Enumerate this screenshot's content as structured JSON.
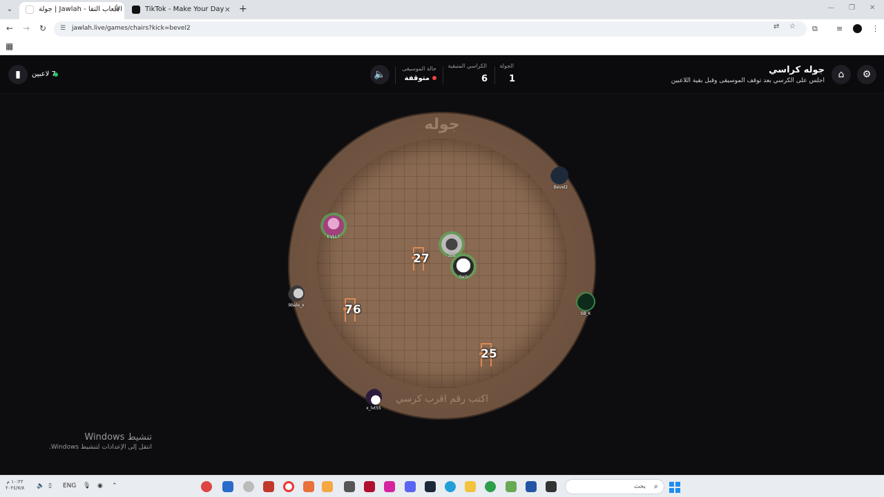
{
  "browser": {
    "tabs": [
      {
        "title": "جولة | Jawlah - منصة الألعاب التفا"
      },
      {
        "title": "TikTok - Make Your Day"
      }
    ],
    "url": "jawlah.live/games/chairs?kick=bevel2",
    "new_tab": "+",
    "close": "×"
  },
  "header": {
    "title": "جوله كراسي",
    "subtitle": "اجلس على الكرسي بعد توقف الموسيقى وقبل بقية اللاعبين",
    "round_label": "الجولة",
    "round_value": "1",
    "chairs_label": "الكراسي المتبقية",
    "chairs_value": "6",
    "music_label": "حالة الموسيقى",
    "music_value": "متوقفة",
    "players_count": "7 لاعبين"
  },
  "board": {
    "brand": "جوله",
    "hint": "اكتب رقم اقرب كرسي",
    "chairs": [
      {
        "number": "27"
      },
      {
        "number": "76"
      },
      {
        "number": "25"
      }
    ],
    "players": [
      {
        "name": "Bevel2"
      },
      {
        "name": "EVLL7"
      },
      {
        "name": "3bd"
      },
      {
        "name": "fer0"
      },
      {
        "name": "9bale_x"
      },
      {
        "name": "SB_K"
      },
      {
        "name": "x_lvt55"
      }
    ]
  },
  "watermark": {
    "title": "تنشيط Windows",
    "subtitle": "انتقل إلى الإعدادات لتنشيط Windows."
  },
  "taskbar": {
    "language": "ENG",
    "search_placeholder": "بحث",
    "clock_time": "١٠:٢٢ م",
    "clock_date": "٢٠٢٤/٧/٨"
  },
  "colors": {
    "accent_green": "#22c55e",
    "music_stopped": "#ef4444",
    "chair": "#d98a55",
    "board": "#7a5b44"
  }
}
